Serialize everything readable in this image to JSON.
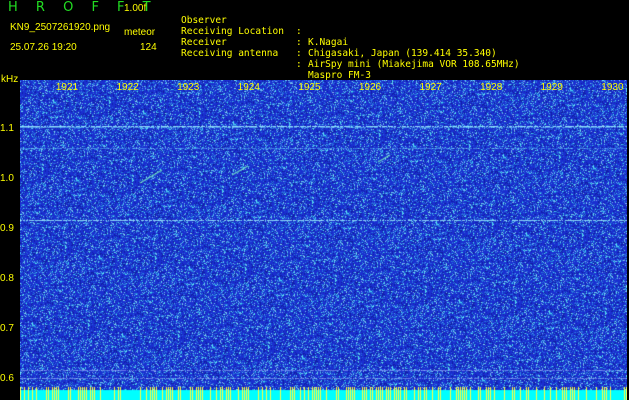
{
  "header": {
    "app_title": "H R O F F T",
    "version": "1.00f",
    "filename": "KN9_2507261920.png",
    "mode": "meteor",
    "datetime": "25.07.26 19:20",
    "count": "124"
  },
  "info": [
    {
      "label": "Observer",
      "sep": ":",
      "value": "K.Nagai"
    },
    {
      "label": "Receiving Location",
      "sep": ":",
      "value": "Chigasaki, Japan (139.414 35.340)"
    },
    {
      "label": "Receiver",
      "sep": ":",
      "value": "AirSpy mini (Miakejima VOR 108.65MHz)"
    },
    {
      "label": "Receiving antenna",
      "sep": ":",
      "value": "Maspro FM-3"
    }
  ],
  "spectrogram": {
    "y_unit": "kHz",
    "y_ticks": [
      "1.1",
      "1.0",
      "0.9",
      "0.8",
      "0.7",
      "0.6"
    ],
    "time_labels": [
      "1921",
      "1922",
      "1923",
      "1924",
      "1925",
      "1926",
      "1927",
      "1928",
      "1929",
      "1930"
    ],
    "colors": {
      "background": "#1a2fd0",
      "noise": "#8fd8ff",
      "label": "#ffff00",
      "bottom_band": "#00ffff"
    }
  }
}
